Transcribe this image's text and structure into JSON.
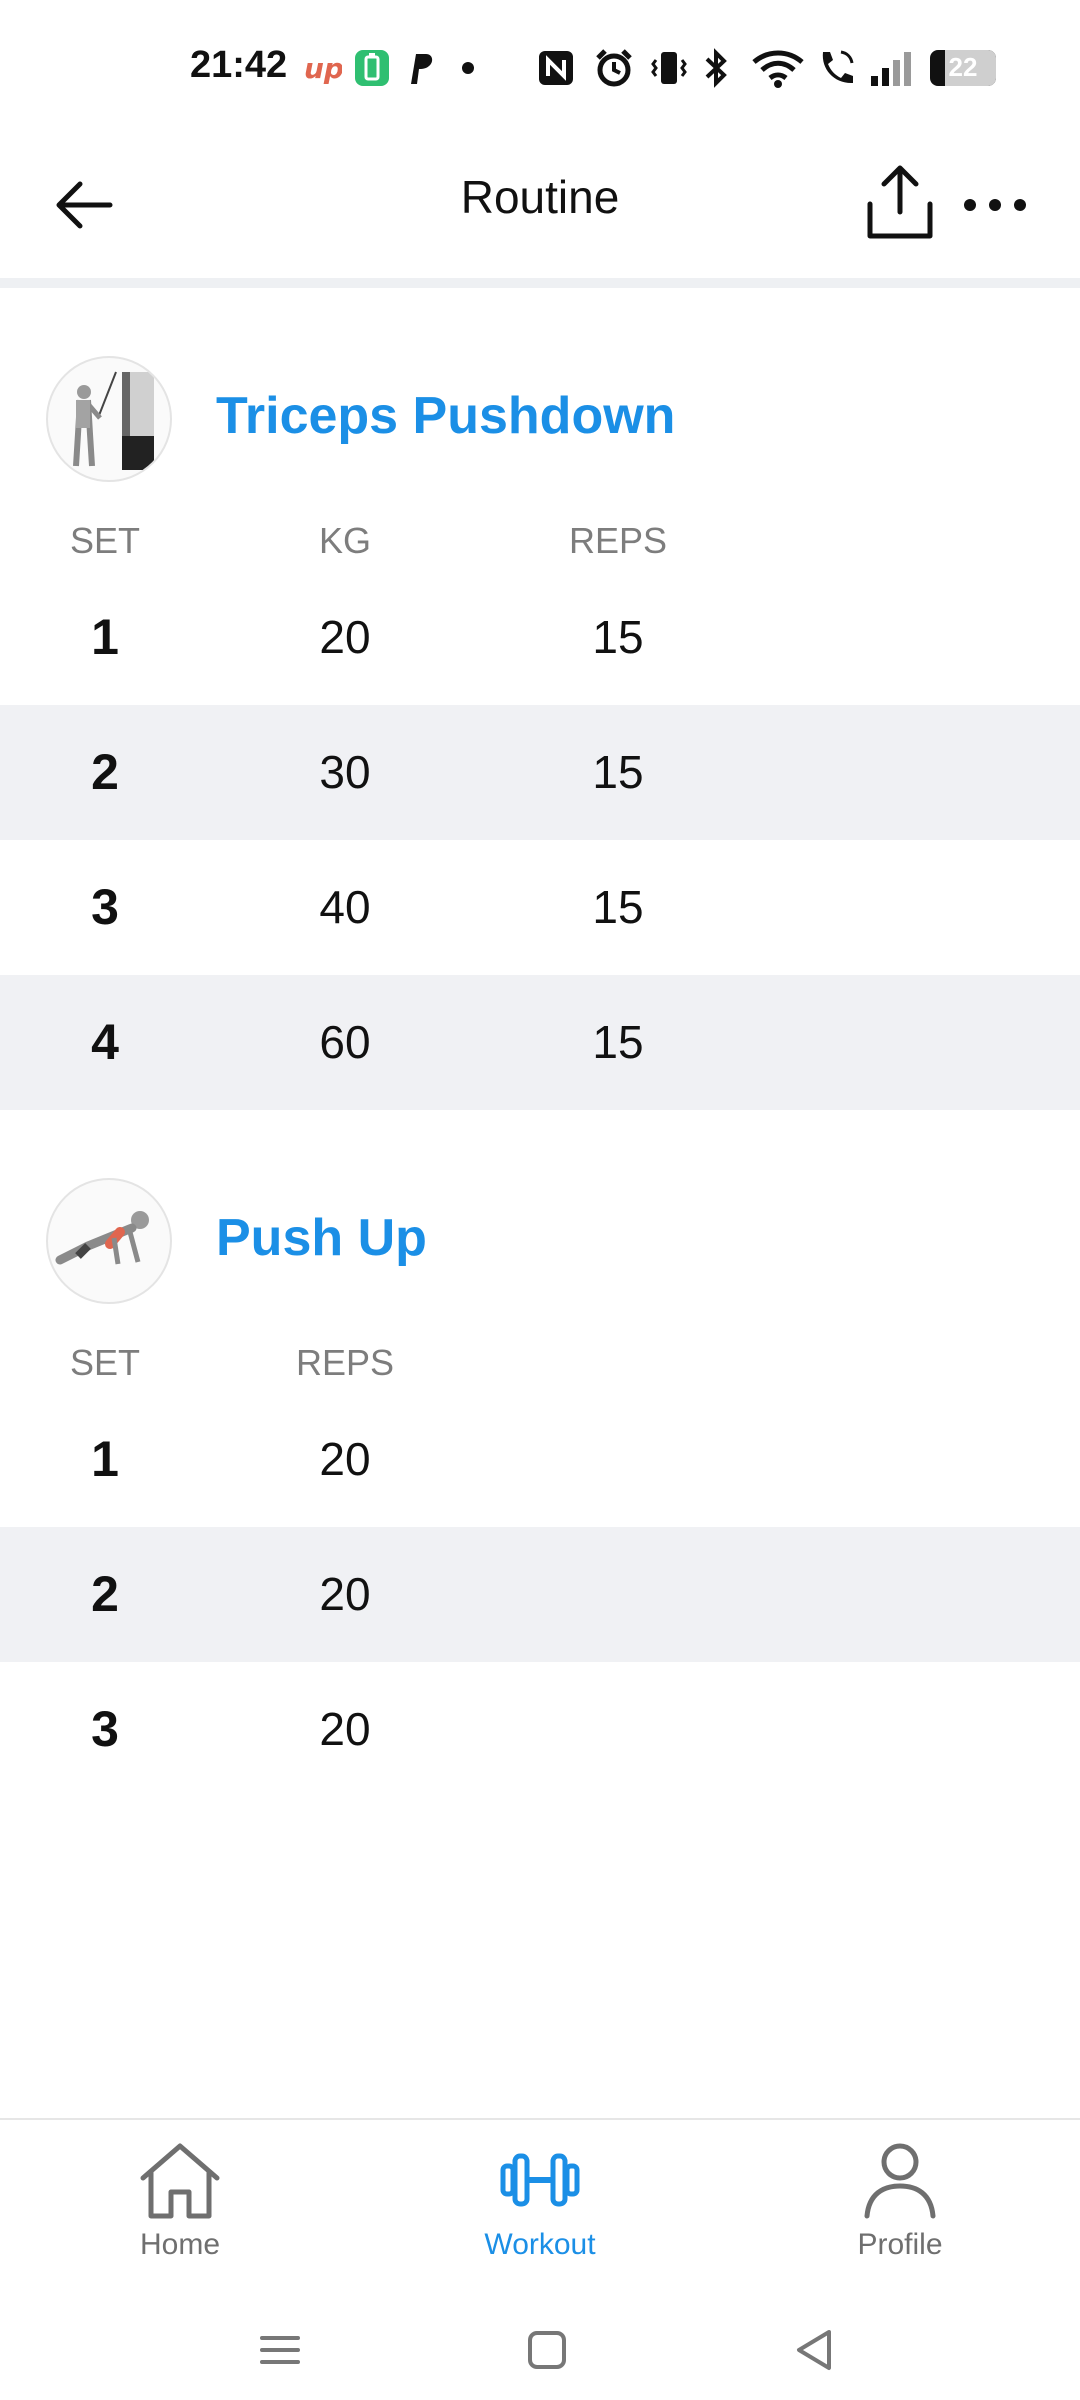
{
  "status_bar": {
    "time": "21:42",
    "battery_level": "22",
    "icons": [
      "up-app-icon",
      "battery-saver-icon",
      "paypal-icon",
      "dot-icon",
      "nfc-icon",
      "alarm-icon",
      "vibrate-icon",
      "bluetooth-icon",
      "wifi-icon",
      "wifi-calling-icon",
      "signal-icon",
      "battery-icon"
    ]
  },
  "app_bar": {
    "title": "Routine",
    "back_icon": "arrow-left-icon",
    "share_icon": "share-icon",
    "more_icon": "more-horizontal-icon"
  },
  "exercises": [
    {
      "name": "Triceps Pushdown",
      "columns": {
        "set": "SET",
        "kg": "KG",
        "reps": "REPS"
      },
      "sets": [
        {
          "set": "1",
          "kg": "20",
          "reps": "15"
        },
        {
          "set": "2",
          "kg": "30",
          "reps": "15"
        },
        {
          "set": "3",
          "kg": "40",
          "reps": "15"
        },
        {
          "set": "4",
          "kg": "60",
          "reps": "15"
        }
      ]
    },
    {
      "name": "Push Up",
      "columns": {
        "set": "SET",
        "reps": "REPS"
      },
      "sets": [
        {
          "set": "1",
          "reps": "20"
        },
        {
          "set": "2",
          "reps": "20"
        },
        {
          "set": "3",
          "reps": "20"
        }
      ]
    }
  ],
  "bottom_nav": {
    "items": [
      {
        "label": "Home",
        "icon": "home-icon",
        "active": false
      },
      {
        "label": "Workout",
        "icon": "dumbbell-icon",
        "active": true
      },
      {
        "label": "Profile",
        "icon": "profile-icon",
        "active": false
      }
    ]
  },
  "colors": {
    "accent": "#1b8fe6",
    "row_alt": "#f0f1f4",
    "muted_text": "#7d7d7d"
  }
}
